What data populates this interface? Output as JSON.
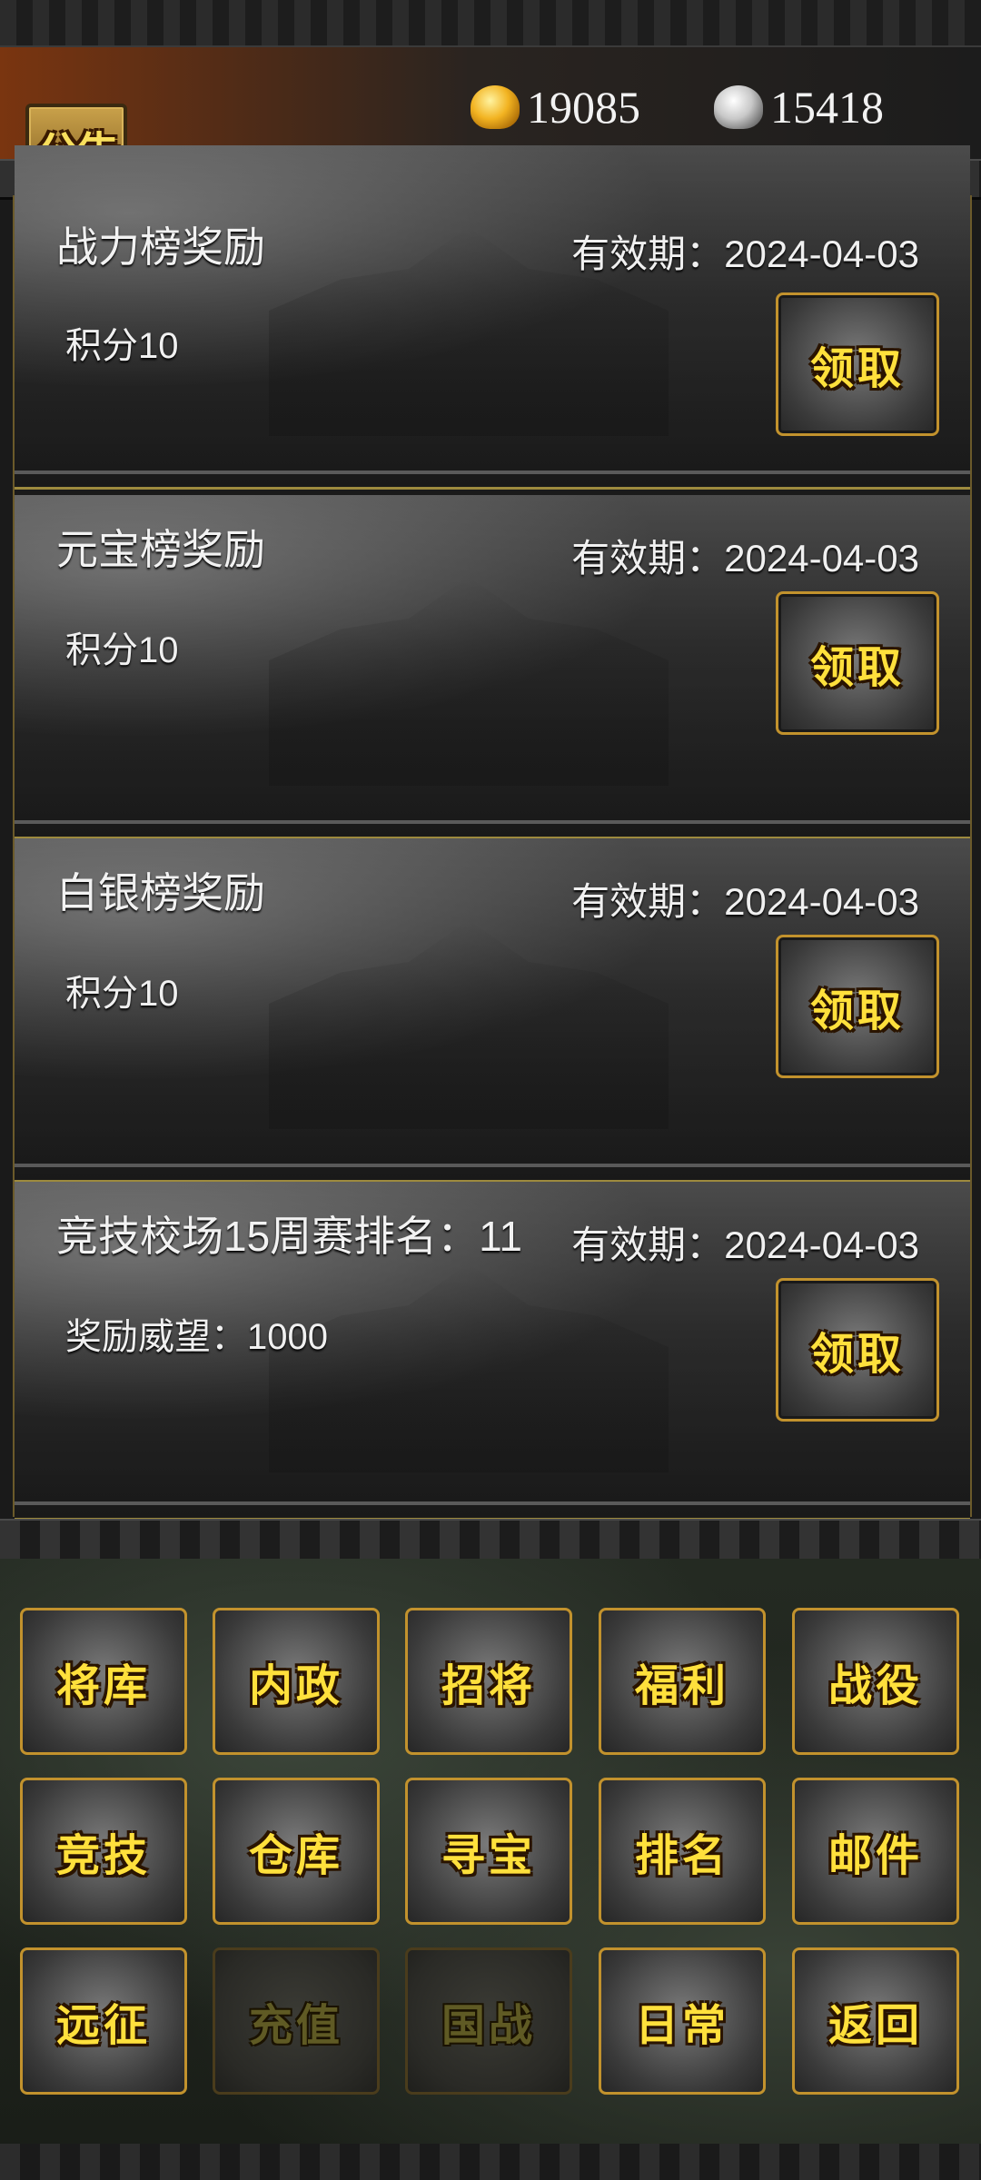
{
  "header": {
    "notice_label": "公告",
    "gold": "19085",
    "silver": "15418",
    "gold_icon": "gold-ingot-icon",
    "silver_icon": "silver-ingot-icon"
  },
  "rewards": [
    {
      "title": "战力榜奖励",
      "expiry": "有效期：2024-04-03",
      "reward": "积分10",
      "claim_label": "领取"
    },
    {
      "title": "元宝榜奖励",
      "expiry": "有效期：2024-04-03",
      "reward": "积分10",
      "claim_label": "领取"
    },
    {
      "title": "白银榜奖励",
      "expiry": "有效期：2024-04-03",
      "reward": "积分10",
      "claim_label": "领取"
    },
    {
      "title": "竞技校场15周赛排名：11",
      "expiry": "有效期：2024-04-03",
      "reward": "奖励威望：1000",
      "claim_label": "领取"
    }
  ],
  "nav": [
    {
      "label": "将库",
      "enabled": true
    },
    {
      "label": "内政",
      "enabled": true
    },
    {
      "label": "招将",
      "enabled": true
    },
    {
      "label": "福利",
      "enabled": true
    },
    {
      "label": "战役",
      "enabled": true
    },
    {
      "label": "竞技",
      "enabled": true
    },
    {
      "label": "仓库",
      "enabled": true
    },
    {
      "label": "寻宝",
      "enabled": true
    },
    {
      "label": "排名",
      "enabled": true
    },
    {
      "label": "邮件",
      "enabled": true
    },
    {
      "label": "远征",
      "enabled": true
    },
    {
      "label": "充值",
      "enabled": false
    },
    {
      "label": "国战",
      "enabled": false
    },
    {
      "label": "日常",
      "enabled": true
    },
    {
      "label": "返回",
      "enabled": true
    }
  ]
}
